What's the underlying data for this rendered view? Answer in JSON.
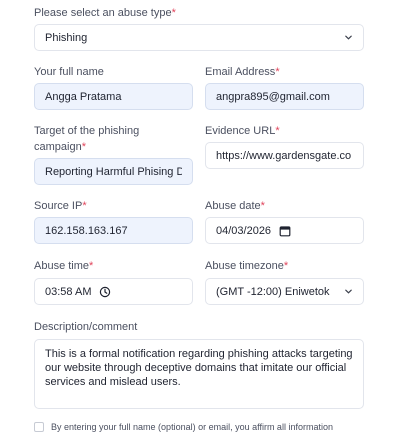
{
  "form": {
    "abuse_type": {
      "label": "Please select an abuse type",
      "value": "Phishing"
    },
    "full_name": {
      "label": "Your full name",
      "value": "Angga Pratama"
    },
    "email": {
      "label": "Email Address",
      "value": "angpra895@gmail.com"
    },
    "target": {
      "label": "Target of the phishing campaign",
      "value": "Reporting Harmful Phising Domain"
    },
    "evidence_url": {
      "label": "Evidence URL",
      "value": "https://www.gardensgate.co"
    },
    "source_ip": {
      "label": "Source IP",
      "value": "162.158.163.167"
    },
    "abuse_date": {
      "label": "Abuse date",
      "value": "04/03/2026"
    },
    "abuse_time": {
      "label": "Abuse time",
      "value": "03:58 AM"
    },
    "abuse_timezone": {
      "label": "Abuse timezone",
      "value": "(GMT -12:00) Eniwetok"
    },
    "description": {
      "label": "Description/comment",
      "value": "This is a formal notification regarding phishing attacks targeting our website through deceptive domains that imitate our official services and mislead users."
    },
    "consent": {
      "text": "By entering your full name (optional) or email, you affirm all information"
    },
    "required_marker": "*"
  },
  "colors": {
    "required": "#e0435a",
    "filled_bg": "#eef3fd",
    "border": "#e2e5ec"
  }
}
